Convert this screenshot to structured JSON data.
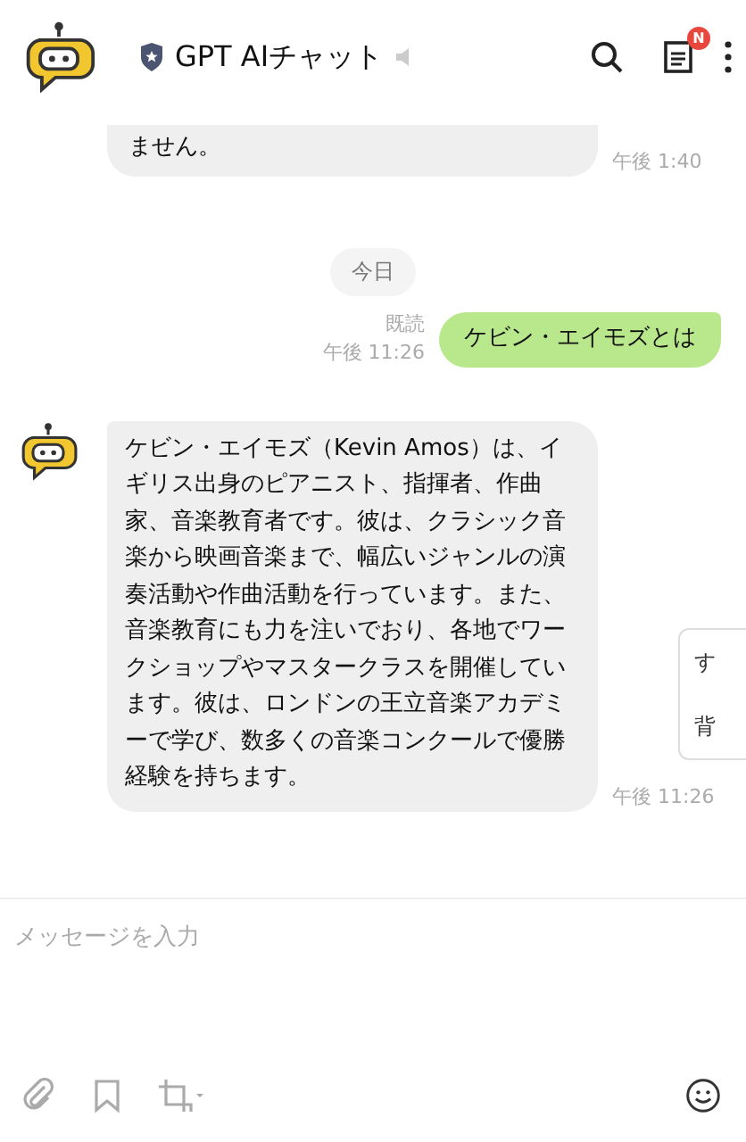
{
  "header": {
    "title": "GPT AIチャット",
    "badge": "N"
  },
  "messages": [
    {
      "kind": "received",
      "avatar": false,
      "text": "ません。",
      "time": "午後 1:40"
    },
    {
      "kind": "date",
      "text": "今日"
    },
    {
      "kind": "sent",
      "read": "既読",
      "text": "ケビン・エイモズとは",
      "time": "午後 11:26"
    },
    {
      "kind": "received",
      "avatar": true,
      "text": "ケビン・エイモズ（Kevin Amos）は、イギリス出身のピアニスト、指揮者、作曲家、音楽教育者です。彼は、クラシック音楽から映画音楽まで、幅広いジャンルの演奏活動や作曲活動を行っています。また、音楽教育にも力を注いでおり、各地でワークショップやマスタークラスを開催しています。彼は、ロンドンの王立音楽アカデミーで学び、数多くの音楽コンクールで優勝経験を持ちます。",
      "time": "午後 11:26"
    }
  ],
  "popup": {
    "lines": [
      "す",
      "背"
    ]
  },
  "composer": {
    "placeholder": "メッセージを入力"
  }
}
